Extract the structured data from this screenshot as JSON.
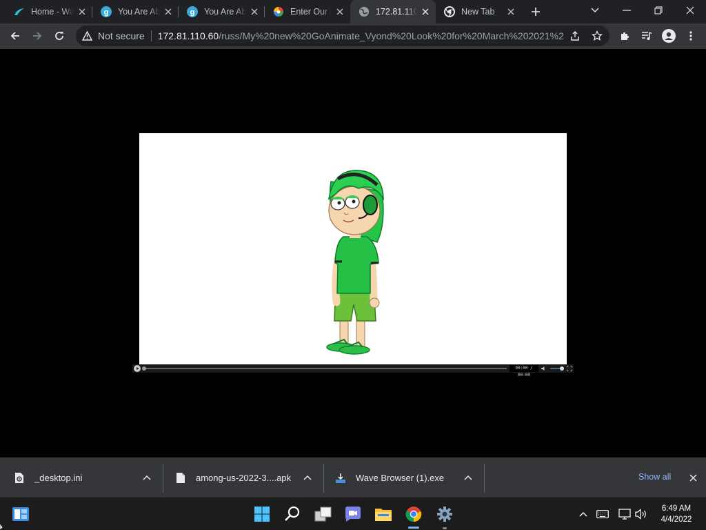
{
  "browser": {
    "tabs": [
      {
        "title": "Home - Wa",
        "icon": "wave-browser-icon"
      },
      {
        "title": "You Are Ab",
        "icon": "gamejolt-g-icon"
      },
      {
        "title": "You Are Ab",
        "icon": "gamejolt-g-icon"
      },
      {
        "title": "Enter Our C",
        "icon": "colorful-pinwheel-icon"
      },
      {
        "title": "172.81.110.",
        "icon": "globe-icon",
        "active": true
      },
      {
        "title": "New Tab",
        "icon": "chrome-icon"
      }
    ],
    "address": {
      "security_label": "Not secure",
      "host": "172.81.110.60",
      "path": "/russ/My%20new%20GoAnimate_Vyond%20Look%20for%20March%202021%2..."
    }
  },
  "video": {
    "time": "00:00 / 00:00",
    "progress": 0
  },
  "downloads": {
    "items": [
      {
        "name": "_desktop.ini",
        "icon": "settings-file-icon"
      },
      {
        "name": "among-us-2022-3....apk",
        "icon": "file-icon"
      },
      {
        "name": "Wave Browser (1).exe",
        "icon": "installer-icon"
      }
    ],
    "show_all": "Show all"
  },
  "taskbar": {
    "time": "6:49 AM",
    "date": "4/4/2022"
  },
  "colors": {
    "accent_blue": "#8ab4f8",
    "tab_bar": "#202124",
    "toolbar": "#35363a",
    "character_green": "#22c55e"
  }
}
